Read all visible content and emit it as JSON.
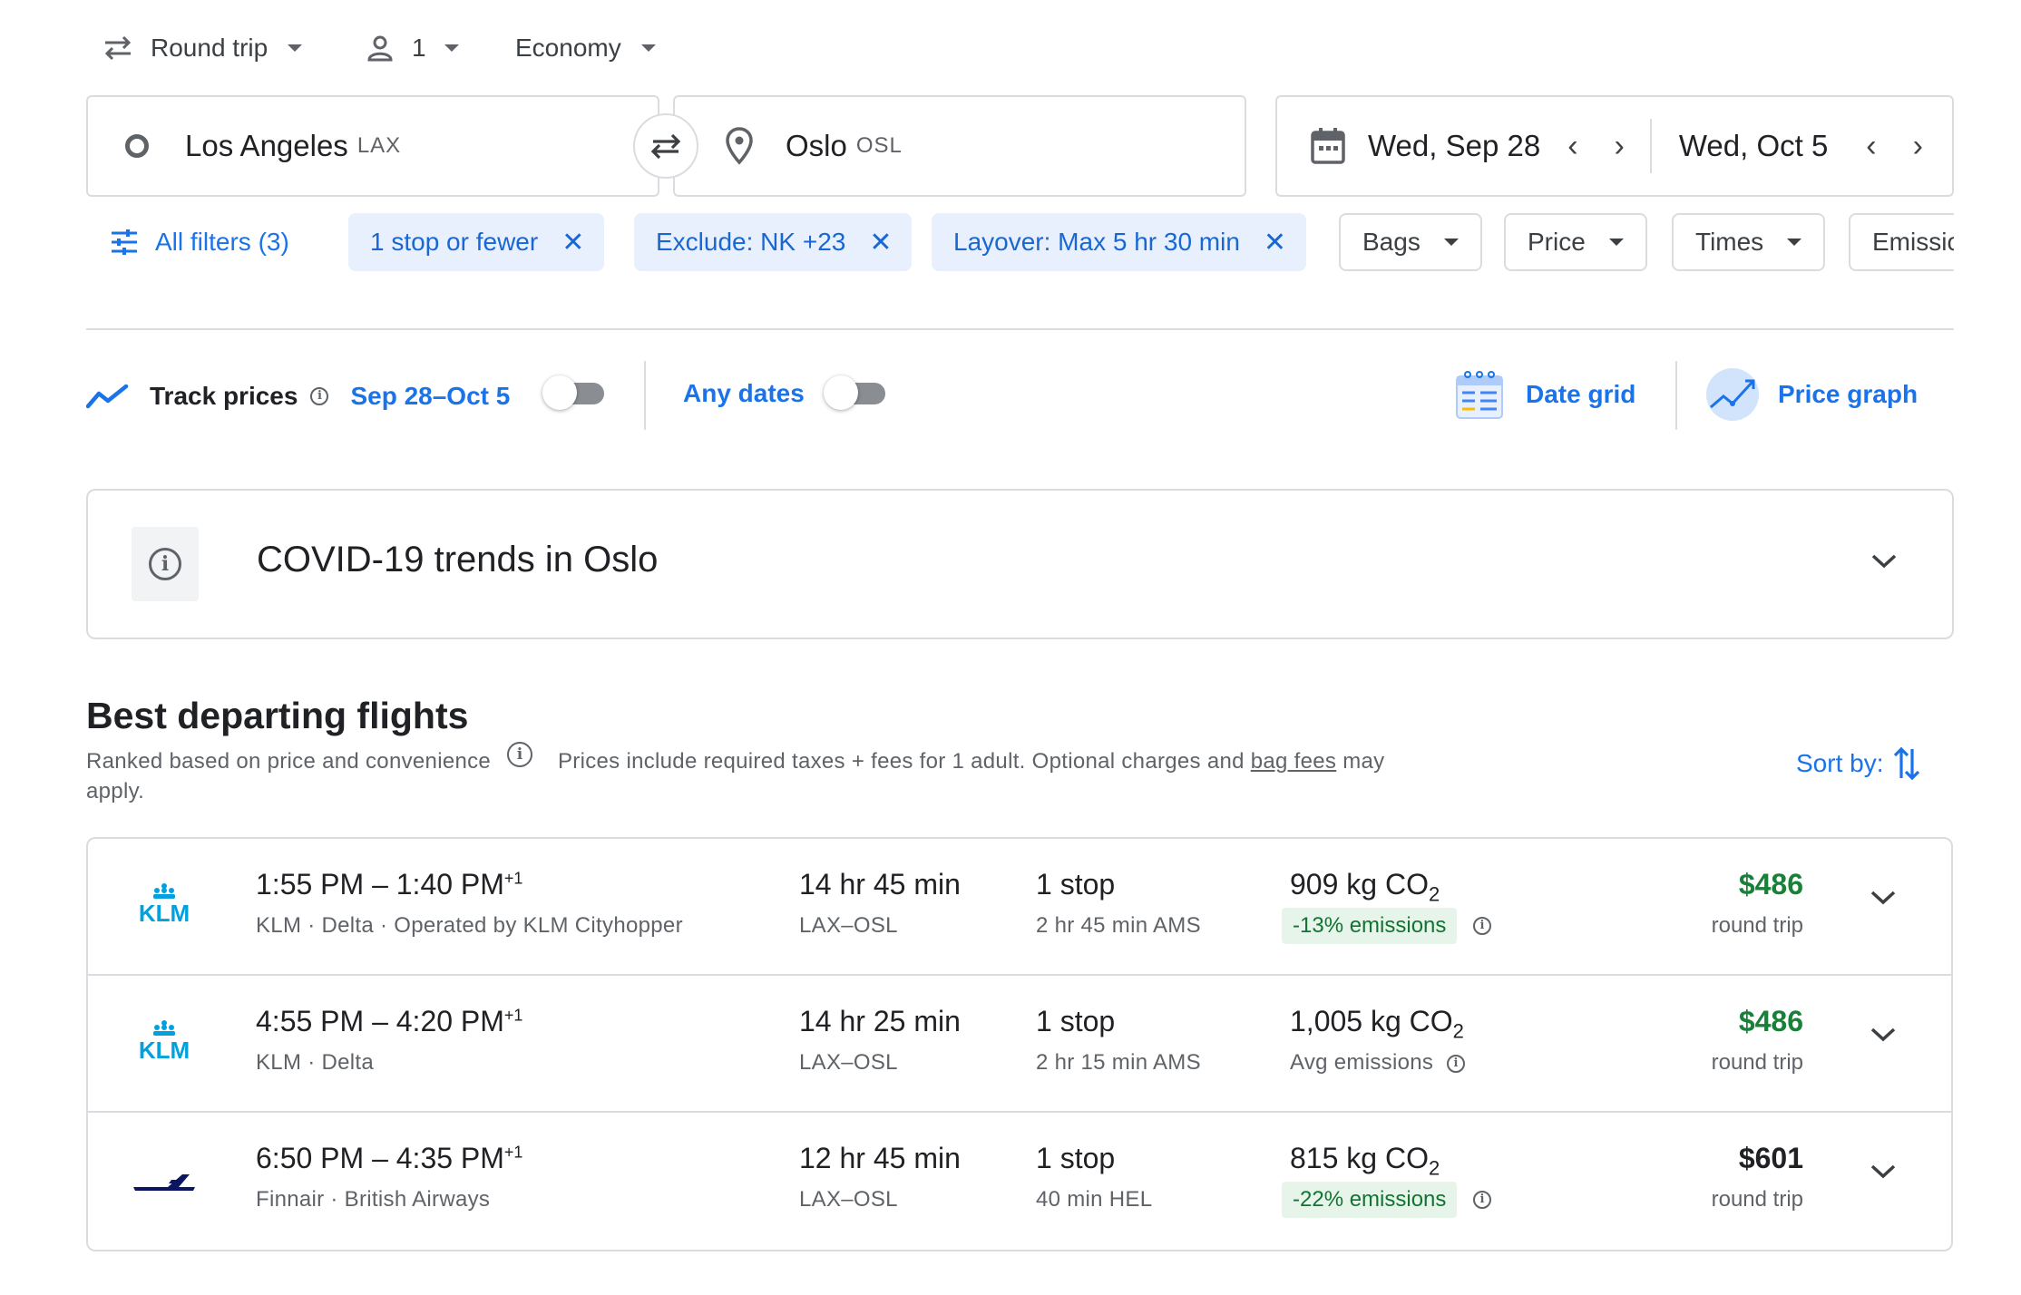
{
  "top": {
    "trip_type": "Round trip",
    "passengers": "1",
    "cabin": "Economy"
  },
  "search": {
    "origin_city": "Los Angeles",
    "origin_code": "LAX",
    "dest_city": "Oslo",
    "dest_code": "OSL",
    "depart_date": "Wed, Sep 28",
    "return_date": "Wed, Oct 5"
  },
  "filters": {
    "all_filters": "All filters (3)",
    "chips_active": [
      "1 stop or fewer",
      "Exclude: NK +23",
      "Layover: Max 5 hr 30 min"
    ],
    "chips_plain": [
      "Bags",
      "Price",
      "Times",
      "Emissic"
    ]
  },
  "tracking": {
    "track_label": "Track prices",
    "track_dates": "Sep 28–Oct 5",
    "any_dates": "Any dates",
    "date_grid": "Date grid",
    "price_graph": "Price graph"
  },
  "covid": {
    "title": "COVID-19 trends in Oslo"
  },
  "section": {
    "title": "Best departing flights",
    "ranked": "Ranked based on price and convenience",
    "prices_note_1": "Prices include required taxes + fees for 1 adult. Optional charges and",
    "bag_fees": "bag fees",
    "prices_note_2": "may",
    "apply": "apply.",
    "sort_by": "Sort by:"
  },
  "flights": [
    {
      "airline_logo": "klm-logo",
      "times": "1:55 PM – 1:40 PM",
      "day_offset": "+1",
      "airlines": "KLM · Delta · Operated by KLM Cityhopper",
      "duration": "14 hr 45 min",
      "route": "LAX–OSL",
      "stops": "1 stop",
      "layover": "2 hr 45 min AMS",
      "co2": "909 kg CO",
      "co2_sub": "2",
      "emissions": "-13% emissions",
      "emissions_badge": true,
      "price": "$486",
      "price_type": "round trip",
      "price_color": "#188038"
    },
    {
      "airline_logo": "klm-logo",
      "times": "4:55 PM – 4:20 PM",
      "day_offset": "+1",
      "airlines": "KLM · Delta",
      "duration": "14 hr 25 min",
      "route": "LAX–OSL",
      "stops": "1 stop",
      "layover": "2 hr 15 min AMS",
      "co2": "1,005 kg CO",
      "co2_sub": "2",
      "emissions": "Avg emissions",
      "emissions_badge": false,
      "price": "$486",
      "price_type": "round trip",
      "price_color": "#188038"
    },
    {
      "airline_logo": "finnair-logo",
      "times": "6:50 PM – 4:35 PM",
      "day_offset": "+1",
      "airlines": "Finnair · British Airways",
      "duration": "12 hr 45 min",
      "route": "LAX–OSL",
      "stops": "1 stop",
      "layover": "40 min HEL",
      "co2": "815 kg CO",
      "co2_sub": "2",
      "emissions": "-22% emissions",
      "emissions_badge": true,
      "price": "$601",
      "price_type": "round trip",
      "price_color": "#202124"
    }
  ],
  "colors": {
    "accent": "#1a73e8",
    "chip_bg": "#e8f0fe",
    "green_price": "#188038",
    "badge_bg": "#e6f4ea",
    "border": "#dadce0"
  }
}
